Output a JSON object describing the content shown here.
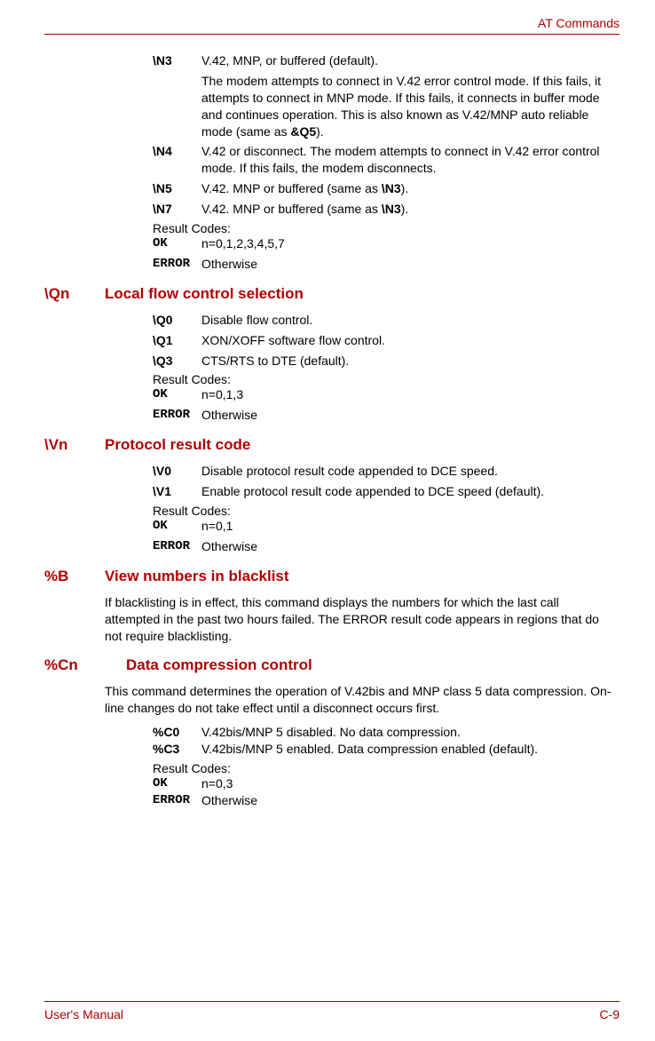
{
  "header": {
    "right": "AT Commands"
  },
  "n_section": {
    "items": [
      {
        "code": "\\N3",
        "text": "V.42, MNP, or buffered (default)."
      },
      {
        "code": "",
        "text_html": "The modem attempts to connect in V.42 error control mode. If this fails, it attempts to connect in MNP mode. If this fails, it connects in buffer mode and continues operation. This is also known as V.42/MNP auto reliable mode (same as <b class='inline'>&amp;Q5</b>)."
      },
      {
        "code": "\\N4",
        "text": "V.42 or disconnect. The modem attempts to connect in V.42 error control mode. If this fails, the modem disconnects."
      },
      {
        "code": "\\N5",
        "text_html": "V.42. MNP or buffered (same as <b class='inline'>\\N3</b>)."
      },
      {
        "code": "\\N7",
        "text_html": "V.42. MNP or buffered (same as <b class='inline'>\\N3</b>)."
      }
    ],
    "result_label": "Result Codes:",
    "ok_code": "OK",
    "ok_text": "n=0,1,2,3,4,5,7",
    "err_code": "ERROR",
    "err_text": "Otherwise"
  },
  "q_section": {
    "cmd": "\\Qn",
    "title": "Local flow control selection",
    "items": [
      {
        "code": "\\Q0",
        "text": "Disable flow control."
      },
      {
        "code": "\\Q1",
        "text": "XON/XOFF software flow control."
      },
      {
        "code": "\\Q3",
        "text": "CTS/RTS to DTE (default)."
      }
    ],
    "result_label": "Result Codes:",
    "ok_code": "OK",
    "ok_text": "n=0,1,3",
    "err_code": "ERROR",
    "err_text": "Otherwise"
  },
  "v_section": {
    "cmd": "\\Vn",
    "title": "Protocol result code",
    "items": [
      {
        "code": "\\V0",
        "text": "Disable protocol result code appended to DCE speed."
      },
      {
        "code": "\\V1",
        "text": "Enable protocol result code appended to DCE speed (default)."
      }
    ],
    "result_label": "Result Codes:",
    "ok_code": "OK",
    "ok_text": "n=0,1",
    "err_code": "ERROR",
    "err_text": "Otherwise"
  },
  "b_section": {
    "cmd": "%B",
    "title": "View numbers in blacklist",
    "body": "If blacklisting is in effect, this command displays the numbers for which the last call attempted in the past two hours failed. The ERROR result code appears in regions that do not require blacklisting."
  },
  "c_section": {
    "cmd": "%Cn",
    "title": "Data compression control",
    "body": "This command determines the operation of V.42bis and MNP class 5 data compression. On-line changes do not take effect until a disconnect occurs first.",
    "items": [
      {
        "code": "%C0",
        "text": "V.42bis/MNP 5 disabled. No data compression."
      },
      {
        "code": "%C3",
        "text": "V.42bis/MNP 5 enabled. Data compression enabled (default)."
      }
    ],
    "result_label": "Result Codes:",
    "ok_code": "OK",
    "ok_text": "n=0,3",
    "err_code": "ERROR",
    "err_text": "Otherwise"
  },
  "footer": {
    "left": "User's Manual",
    "right": "C-9"
  }
}
